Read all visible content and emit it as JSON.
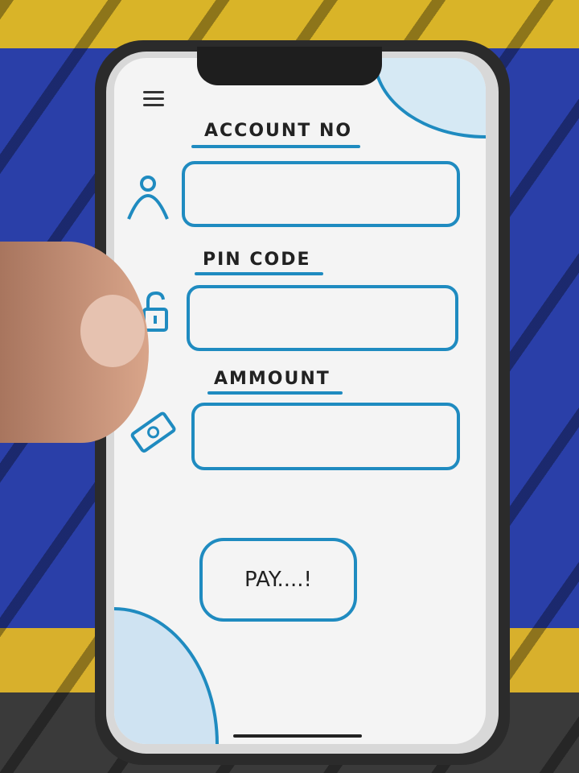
{
  "form": {
    "account_label": "ACCOUNT NO",
    "pin_label": "PIN CODE",
    "amount_label": "AMMOUNT",
    "pay_button": "PAY....!"
  },
  "icons": {
    "menu": "hamburger-icon",
    "account": "user-icon",
    "pin": "lock-icon",
    "amount": "cash-icon"
  },
  "colors": {
    "accent": "#1f8bc0"
  }
}
